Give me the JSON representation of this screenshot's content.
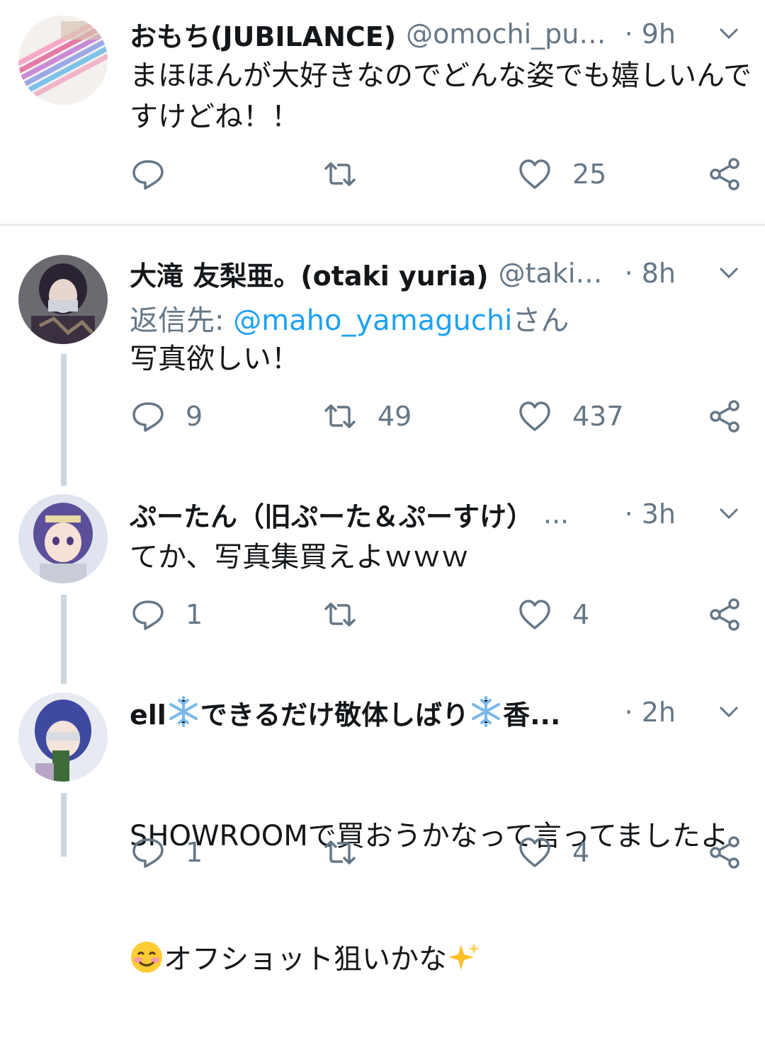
{
  "tweets": [
    {
      "name": "おもち(JUBILANCE)",
      "handle": "@omochi_puk...",
      "time": "· 9h",
      "text": "まほほんが大好きなのでどんな姿でも嬉しいんですけどね！！",
      "replies": "",
      "retweets": "",
      "likes": "25"
    },
    {
      "name": "大滝 友梨亜。(otaki yuria)",
      "handle": "@takim...",
      "time": "· 8h",
      "reply_prefix": "返信先: ",
      "reply_mention": "@maho_yamaguchi",
      "reply_suffix": "さん",
      "text": "写真欲しい！",
      "replies": "9",
      "retweets": "49",
      "likes": "437"
    },
    {
      "name": "ぷーたん（旧ぷーた＆ぷーすけ）",
      "handle": "...",
      "time": "· 3h",
      "text": "てか、写真集買えよｗｗｗ",
      "replies": "1",
      "retweets": "",
      "likes": "4"
    },
    {
      "name_part1": "ell",
      "name_part2": "できるだけ敬体しばり",
      "name_part3": "香...",
      "time": "· 2h",
      "text_line1": "SHOWROOMで買おうかなって言ってましたよ",
      "text_line2": "オフショット狙いかな",
      "replies": "1",
      "retweets": "",
      "likes": "4"
    }
  ],
  "icons": {
    "reply": "reply-icon",
    "retweet": "retweet-icon",
    "like": "heart-icon",
    "share": "share-icon",
    "caret": "chevron-down-icon"
  },
  "colors": {
    "text": "#14171a",
    "secondary": "#657786",
    "link": "#1da1f2",
    "thread_line": "#ccd6dd"
  }
}
